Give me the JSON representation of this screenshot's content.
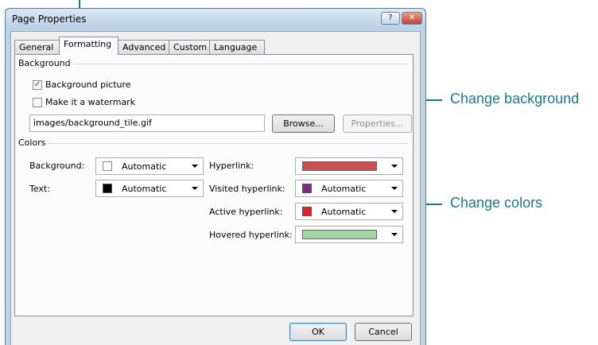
{
  "window": {
    "title": "Page Properties",
    "help_glyph": "?",
    "close_glyph": "✕"
  },
  "tabs": [
    {
      "label": "General"
    },
    {
      "label": "Formatting"
    },
    {
      "label": "Advanced"
    },
    {
      "label": "Custom"
    },
    {
      "label": "Language"
    }
  ],
  "background": {
    "group_label": "Background",
    "picture_checkbox": {
      "label": "Background picture",
      "checked": true
    },
    "watermark_checkbox": {
      "label": "Make it a watermark",
      "checked": false
    },
    "file_value": "images/background_tile.gif",
    "browse_label": "Browse...",
    "properties_label": "Properties..."
  },
  "colors": {
    "group_label": "Colors",
    "background": {
      "label": "Background:",
      "value": "Automatic",
      "swatch": "#ffffff"
    },
    "text": {
      "label": "Text:",
      "value": "Automatic",
      "swatch": "#000000"
    },
    "hyperlink": {
      "label": "Hyperlink:",
      "swatch": "#c9504f"
    },
    "visited": {
      "label": "Visited hyperlink:",
      "value": "Automatic",
      "swatch": "#7a2a82"
    },
    "active": {
      "label": "Active hyperlink:",
      "value": "Automatic",
      "swatch": "#e0232a"
    },
    "hovered": {
      "label": "Hovered hyperlink:",
      "swatch": "#a3d4a3"
    }
  },
  "footer": {
    "ok_label": "OK",
    "cancel_label": "Cancel"
  },
  "annotations": {
    "change_background": "Change background",
    "change_colors": "Change colors",
    "accent": "#1a7a8c"
  }
}
